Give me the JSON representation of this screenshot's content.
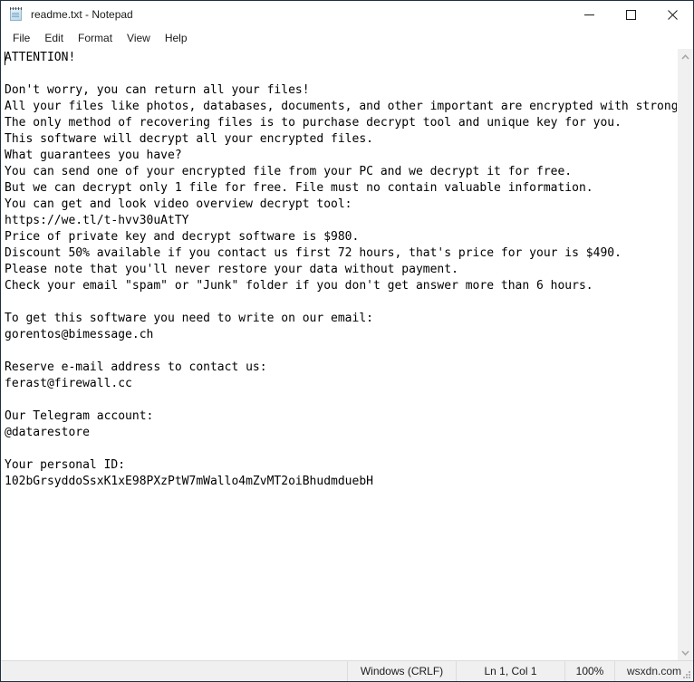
{
  "window": {
    "title": "readme.txt - Notepad",
    "icon": "notepad-icon",
    "controls": {
      "minimize": "Minimize",
      "maximize": "Maximize",
      "close": "Close"
    }
  },
  "menubar": {
    "items": [
      {
        "label": "File"
      },
      {
        "label": "Edit"
      },
      {
        "label": "Format"
      },
      {
        "label": "View"
      },
      {
        "label": "Help"
      }
    ]
  },
  "editor": {
    "content": "ATTENTION!\n\nDon't worry, you can return all your files!\nAll your files like photos, databases, documents, and other important are encrypted with strongest encryption and unique key.\nThe only method of recovering files is to purchase decrypt tool and unique key for you.\nThis software will decrypt all your encrypted files.\nWhat guarantees you have?\nYou can send one of your encrypted file from your PC and we decrypt it for free.\nBut we can decrypt only 1 file for free. File must no contain valuable information.\nYou can get and look video overview decrypt tool:\nhttps://we.tl/t-hvv30uAtTY\nPrice of private key and decrypt software is $980.\nDiscount 50% available if you contact us first 72 hours, that's price for your is $490.\nPlease note that you'll never restore your data without payment.\nCheck your email \"spam\" or \"Junk\" folder if you don't get answer more than 6 hours.\n\nTo get this software you need to write on our email:\ngorentos@bimessage.ch\n\nReserve e-mail address to contact us:\nferast@firewall.cc\n\nOur Telegram account:\n@datarestore\n\nYour personal ID:\n102bGrsyddoSsxK1xE98PXzPtW7mWallo4mZvMT2oiBhudmduebH",
    "lines": [
      "ATTENTION!",
      "",
      "Don't worry, you can return all your files!",
      "All your files like photos, databases, documents, and other important are encrypted with",
      "strongest encryption and unique key.",
      "The only method of recovering files is to purchase decrypt tool and unique key for you.",
      "This software will decrypt all your encrypted files.",
      "What guarantees you have?",
      "You can send one of your encrypted file from your PC and we decrypt it for free.",
      "But we can decrypt only 1 file for free. File must no contain valuable information.",
      "You can get and look video overview decrypt tool:",
      "https://we.tl/t-hvv30uAtTY",
      "Price of private key and decrypt software is $980.",
      "Discount 50% available if you contact us first 72 hours, that's price for your is $490.",
      "Please note that you'll never restore your data without payment.",
      "Check your email \"spam\" or \"Junk\" folder if you don't get answer more than 6 hours.",
      "",
      "To get this software you need to write on our email:",
      "gorentos@bimessage.ch",
      "",
      "Reserve e-mail address to contact us:",
      "ferast@firewall.cc",
      "",
      "Our Telegram account:",
      "@datarestore",
      "",
      "Your personal ID:",
      "102bGrsyddoSsxK1xE98PXzPtW7mWallo4mZvMT2oiBhudmduebH"
    ],
    "details": {
      "video_url": "https://we.tl/t-hvv30uAtTY",
      "price": "$980",
      "discount_price": "$490",
      "discount_percent": "50%",
      "discount_window": "72 hours",
      "response_time": "6 hours",
      "primary_email": "gorentos@bimessage.ch",
      "reserve_email": "ferast@firewall.cc",
      "telegram": "@datarestore",
      "personal_id": "102bGrsyddoSsxK1xE98PXzPtW7mWallo4mZvMT2oiBhudmduebH"
    }
  },
  "scrollbar": {
    "up_arrow": "chevron-up-icon",
    "down_arrow": "chevron-down-icon"
  },
  "statusbar": {
    "line_ending": "Windows (CRLF)",
    "cursor_position": "Ln 1, Col 1",
    "zoom": "100%",
    "watermark": "wsxdn.com"
  },
  "colors": {
    "window_border": "#1d3040",
    "titlebar_bg": "#ffffff",
    "statusbar_bg": "#f0f0f0",
    "text": "#000000",
    "separator": "#dcdcdc"
  }
}
